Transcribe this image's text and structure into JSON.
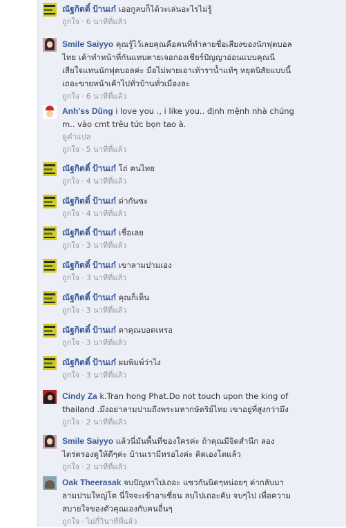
{
  "comments": [
    {
      "author": "ณัฐกิตติ์ ป้านเก๋",
      "avatar": "yellow-banner-avatar",
      "lines": [
        "เออกูลบก็ได้วะเล่นอะไรไม่รู้"
      ],
      "like": "ถูกใจ",
      "time": "6 นาทีที่แล้ว"
    },
    {
      "author": "Smile Saiyyo",
      "avatar": "girl-avatar",
      "lines": [
        "คุณรู้ไว้เลยคุณคือคนที่ทำลายชื่อเสียงของนักฟุตบอล",
        "ไทย เค้าทำหน้าที่กันแทบตายเจอกองเชียร์ปัญญาอ่อนแบบคุณนี",
        "เสียใจแทนนักฟุตบอลค่ะ มือไม่พายเอาเท้าราน้ำแท้ๆ หยุดนิสัยแบบนี้",
        "เถอะขายหน้าเค้าไปทั่วบ้านทั่วเมืองละ"
      ],
      "like": "ถูกใจ",
      "time": "6 นาทีที่แล้ว"
    },
    {
      "author": "Anh'ss Dũng",
      "avatar": "santa-avatar",
      "lines": [
        "i love you ., i like you.. định mệnh nhà chúng",
        "m.. vào cmt trêu tức bọn tao à."
      ],
      "translate": "ดูคำแปล",
      "like": "ถูกใจ",
      "time": "5 นาทีที่แล้ว"
    },
    {
      "author": "ณัฐกิตติ์ ป้านเก๋",
      "avatar": "yellow-banner-avatar",
      "lines": [
        "โถ่ คนไทย"
      ],
      "like": "ถูกใจ",
      "time": "4 นาทีที่แล้ว"
    },
    {
      "author": "ณัฐกิตติ์ ป้านเก๋",
      "avatar": "yellow-banner-avatar",
      "lines": [
        "ด่ากันซะ"
      ],
      "like": "ถูกใจ",
      "time": "4 นาทีที่แล้ว"
    },
    {
      "author": "ณัฐกิตติ์ ป้านเก๋",
      "avatar": "yellow-banner-avatar",
      "lines": [
        "เชื่อเลย"
      ],
      "like": "ถูกใจ",
      "time": "3 นาทีที่แล้ว"
    },
    {
      "author": "ณัฐกิตติ์ ป้านเก๋",
      "avatar": "yellow-banner-avatar",
      "lines": [
        "เขาลามปามเอง"
      ],
      "like": "ถูกใจ",
      "time": "3 นาทีที่แล้ว"
    },
    {
      "author": "ณัฐกิตติ์ ป้านเก๋",
      "avatar": "yellow-banner-avatar",
      "lines": [
        "คุณก็เห็น"
      ],
      "like": "ถูกใจ",
      "time": "3 นาทีที่แล้ว"
    },
    {
      "author": "ณัฐกิตติ์ ป้านเก๋",
      "avatar": "yellow-banner-avatar",
      "lines": [
        "ตาคุณบอดเหรอ"
      ],
      "like": "ถูกใจ",
      "time": "3 นาทีที่แล้ว"
    },
    {
      "author": "ณัฐกิตติ์ ป้านเก๋",
      "avatar": "yellow-banner-avatar",
      "lines": [
        "ผมพิมพ์ว่าไง"
      ],
      "like": "ถูกใจ",
      "time": "3 นาทีที่แล้ว"
    },
    {
      "author": "Cindy Za",
      "avatar": "red-hair-avatar",
      "lines": [
        "k.Tran hong Phat.Do not touch upon the king of",
        "thailand .มึงอย่าลามปามถึงพระมหากษัตริย์ไทย เขาอยู่ที่สูงกว่ามึง"
      ],
      "like": "ถูกใจ",
      "time": "2 นาทีที่แล้ว"
    },
    {
      "author": "Smile Saiyyo",
      "avatar": "girl-avatar",
      "lines": [
        "แล้วนี่มันพื้นที่ของใครค่ะ ถ้าคุณมีจิตสำนึก ลอง",
        "ไตร่ตรองดูให้ดีๆค่ะ บ้านเรามีหรอไงค่ะ คิดเองโตแล้ว"
      ],
      "like": "ถูกใจ",
      "time": "2 นาทีที่แล้ว"
    },
    {
      "author": "Oak Theerasak",
      "avatar": "dog-avatar",
      "lines": [
        "จบปัญหาไปเถอะ แซวกันนิดๆหน่อยๆ ด่ากลับมา",
        "ลามปามใหญ่โต นี่ใจจะเข้าอาเซี่ยน ลบไปเถอะคับ จบๆไป เพื่อความ",
        "สบายใจของตัวคุณเองกับคนอื่นๆ"
      ],
      "like": "ถูกใจ",
      "time": "ไม่กี่วินาทีที่แล้ว"
    }
  ]
}
